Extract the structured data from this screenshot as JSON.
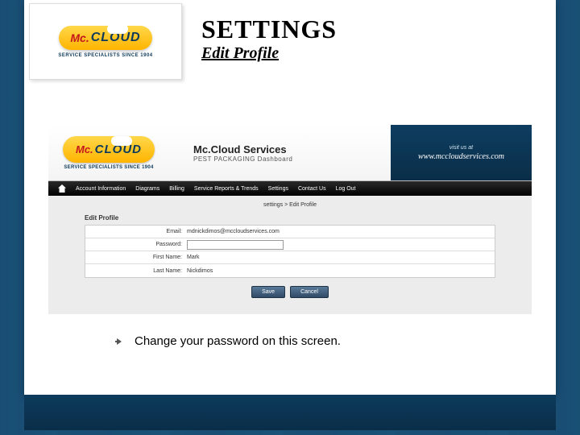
{
  "logo": {
    "prefix": "Mc.",
    "main": "CLOUD",
    "tagline": "SERVICE SPECIALISTS SINCE 1904"
  },
  "heading": {
    "title": "SETTINGS",
    "subtitle": "Edit Profile"
  },
  "screenshot": {
    "header": {
      "title": "Mc.Cloud Services",
      "subtitle": "PEST PACKAGING Dashboard",
      "visit": "visit us at",
      "url": "www.mccloudservices.com"
    },
    "nav": [
      "Account Information",
      "Diagrams",
      "Billing",
      "Service Reports & Trends",
      "Settings",
      "Contact Us",
      "Log Out"
    ],
    "breadcrumb": "settings > Edit Profile",
    "panel_title": "Edit Profile",
    "fields": {
      "email_label": "Email:",
      "email_value": "mdnickdimos@mccloudservices.com",
      "password_label": "Password:",
      "first_label": "First Name:",
      "first_value": "Mark",
      "last_label": "Last Name:",
      "last_value": "Nickdimos"
    },
    "buttons": {
      "save": "Save",
      "cancel": "Cancel"
    }
  },
  "bullet": "Change your password on this screen."
}
